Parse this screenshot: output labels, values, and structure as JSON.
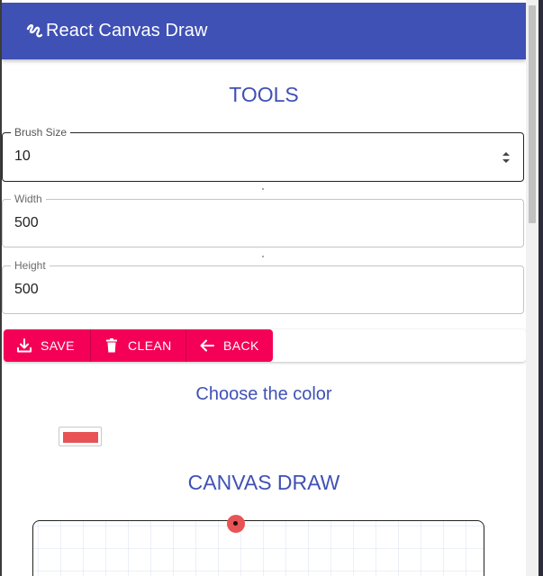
{
  "app": {
    "title": "React Canvas Draw",
    "bar_color": "#3f51b5",
    "logo_icon": "scribble-icon"
  },
  "tools": {
    "title": "TOOLS",
    "brush_size": {
      "label": "Brush Size",
      "value": "10"
    },
    "width": {
      "label": "Width",
      "value": "500"
    },
    "height": {
      "label": "Height",
      "value": "500"
    }
  },
  "actions": {
    "button_color": "#f50057",
    "save": {
      "label": "SAVE",
      "icon": "download-icon"
    },
    "clean": {
      "label": "CLEAN",
      "icon": "trash-icon"
    },
    "back": {
      "label": "BACK",
      "icon": "arrow-left-icon"
    }
  },
  "color_picker": {
    "title": "Choose the color",
    "selected_color": "#e85355"
  },
  "canvas": {
    "title": "CANVAS DRAW",
    "brush_color": "#e85355"
  }
}
